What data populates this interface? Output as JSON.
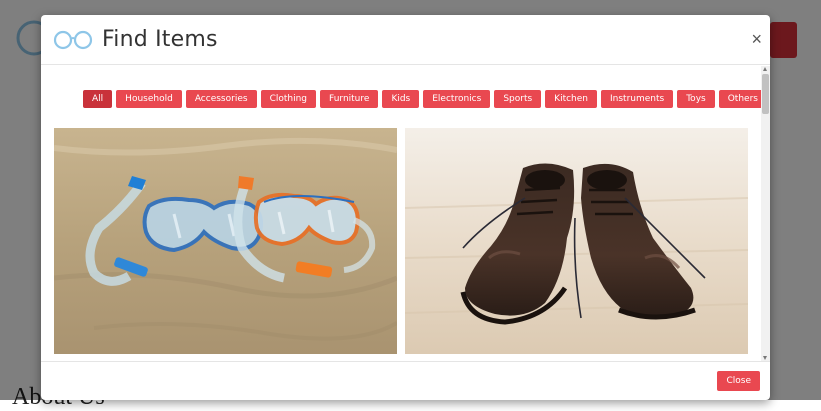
{
  "background": {
    "heading": "About Us"
  },
  "modal": {
    "title": "Find Items",
    "close_symbol": "×",
    "filters": [
      "All",
      "Household",
      "Accessories",
      "Clothing",
      "Furniture",
      "Kids",
      "Electronics",
      "Sports",
      "Kitchen",
      "Instruments",
      "Toys",
      "Others"
    ],
    "active_filter": "All",
    "items": [
      {
        "image": "snorkel-masks-on-sand"
      },
      {
        "image": "brown-leather-shoes"
      }
    ],
    "footer": {
      "close_label": "Close"
    }
  },
  "colors": {
    "accent": "#e94850",
    "accent_active": "#c9323a",
    "logo_blue": "#8ec6e8"
  },
  "icons": [
    "glasses-logo-icon",
    "close-icon"
  ]
}
